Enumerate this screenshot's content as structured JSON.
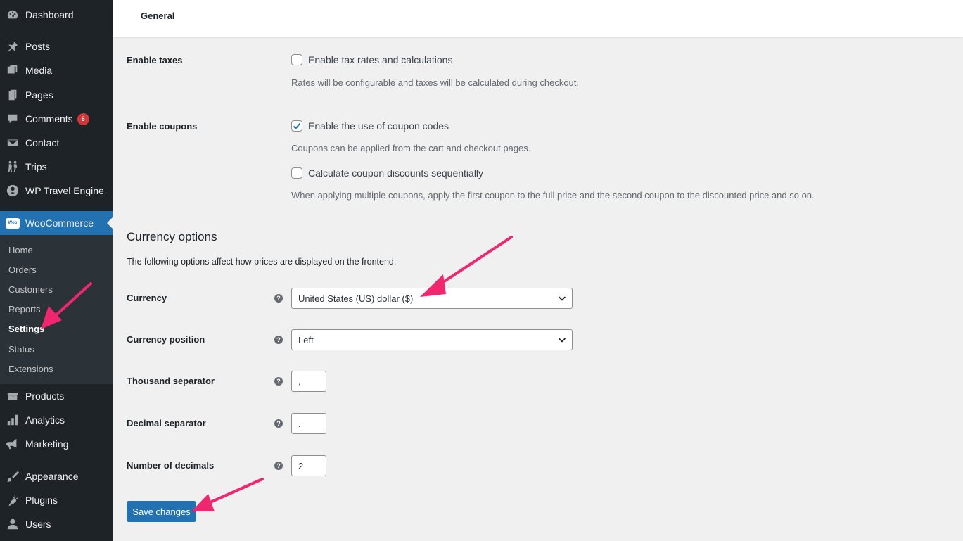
{
  "sidebar": {
    "items": [
      {
        "label": "Dashboard",
        "icon": "dashboard-icon"
      },
      {
        "label": "Posts",
        "icon": "pin-icon"
      },
      {
        "label": "Media",
        "icon": "media-icon"
      },
      {
        "label": "Pages",
        "icon": "pages-icon"
      },
      {
        "label": "Comments",
        "icon": "comment-icon",
        "badge": "6"
      },
      {
        "label": "Contact",
        "icon": "mail-icon"
      },
      {
        "label": "Trips",
        "icon": "hikers-icon"
      },
      {
        "label": "WP Travel Engine",
        "icon": "travel-engine-icon"
      },
      {
        "label": "WooCommerce",
        "icon": "woo-icon",
        "logo_text": "Woo"
      },
      {
        "label": "Products",
        "icon": "products-icon"
      },
      {
        "label": "Analytics",
        "icon": "bar-chart-icon"
      },
      {
        "label": "Marketing",
        "icon": "megaphone-icon"
      },
      {
        "label": "Appearance",
        "icon": "brush-icon"
      },
      {
        "label": "Plugins",
        "icon": "plug-icon"
      },
      {
        "label": "Users",
        "icon": "user-icon"
      }
    ],
    "submenu": [
      "Home",
      "Orders",
      "Customers",
      "Reports",
      "Settings",
      "Status",
      "Extensions"
    ],
    "active_color": "#2271b1"
  },
  "header": {
    "tab": "General"
  },
  "taxes": {
    "label": "Enable taxes",
    "checkbox_label": "Enable tax rates and calculations",
    "checked": false,
    "description": "Rates will be configurable and taxes will be calculated during checkout."
  },
  "coupons": {
    "label": "Enable coupons",
    "checkbox_label": "Enable the use of coupon codes",
    "checked": true,
    "description": "Coupons can be applied from the cart and checkout pages.",
    "sequential_label": "Calculate coupon discounts sequentially",
    "sequential_checked": false,
    "sequential_description": "When applying multiple coupons, apply the first coupon to the full price and the second coupon to the discounted price and so on."
  },
  "currency_options": {
    "title": "Currency options",
    "description": "The following options affect how prices are displayed on the frontend.",
    "currency_label": "Currency",
    "currency_value": "United States (US) dollar ($)",
    "position_label": "Currency position",
    "position_value": "Left",
    "thousand_label": "Thousand separator",
    "thousand_value": ",",
    "decimal_label": "Decimal separator",
    "decimal_value": ".",
    "decimals_label": "Number of decimals",
    "decimals_value": "2",
    "help_glyph": "?"
  },
  "actions": {
    "save_label": "Save changes"
  },
  "annotation_color": "#f0266f"
}
